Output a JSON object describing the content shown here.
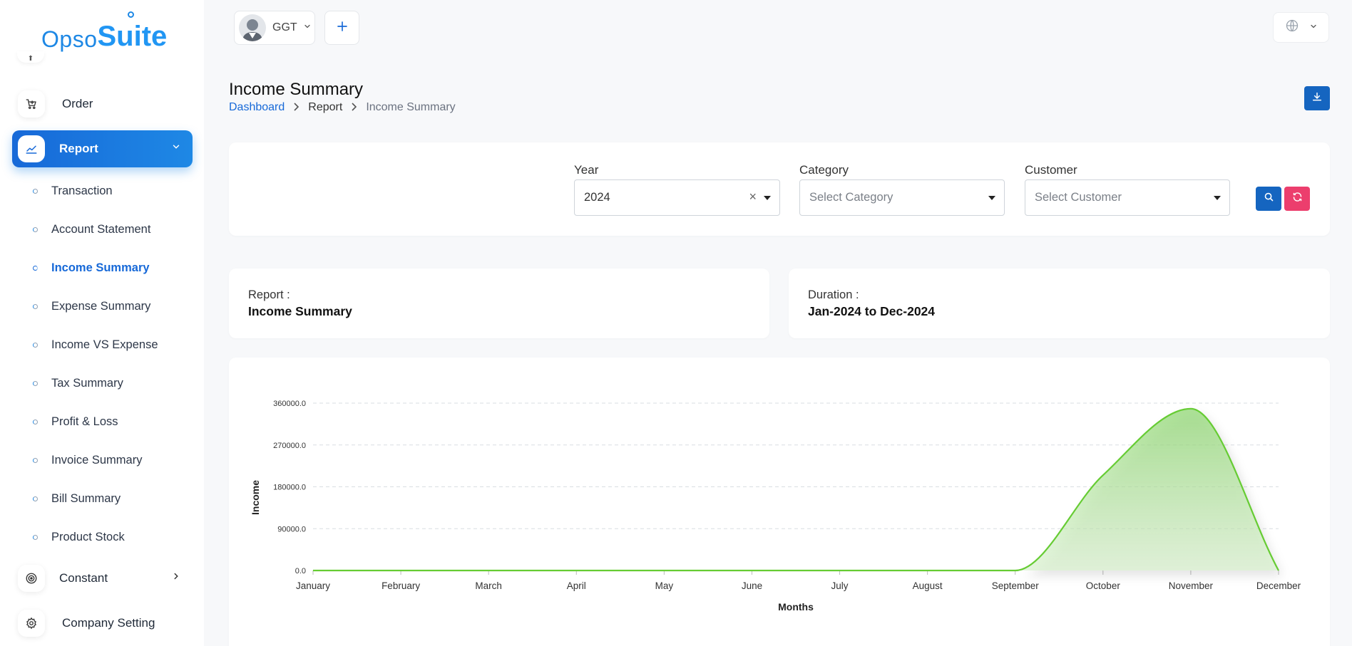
{
  "app": {
    "logo_part1": "Opso",
    "logo_part2": "Suite"
  },
  "topbar": {
    "company_name": "GGT"
  },
  "sidebar": {
    "items": [
      {
        "label": "Order",
        "icon": "cart-icon"
      },
      {
        "label": "Report",
        "icon": "chart-line-icon",
        "active": true,
        "expanded": true
      },
      {
        "label": "Constant",
        "icon": "target-icon"
      },
      {
        "label": "Company Setting",
        "icon": "gear-icon"
      }
    ],
    "report_sub": [
      {
        "label": "Transaction"
      },
      {
        "label": "Account Statement"
      },
      {
        "label": "Income Summary",
        "active": true
      },
      {
        "label": "Expense Summary"
      },
      {
        "label": "Income VS Expense"
      },
      {
        "label": "Tax Summary"
      },
      {
        "label": "Profit & Loss"
      },
      {
        "label": "Invoice Summary"
      },
      {
        "label": "Bill Summary"
      },
      {
        "label": "Product Stock"
      }
    ]
  },
  "page": {
    "title": "Income Summary",
    "breadcrumb": [
      "Dashboard",
      "Report",
      "Income Summary"
    ]
  },
  "filters": {
    "year_label": "Year",
    "year_value": "2024",
    "clear_symbol": "×",
    "category_label": "Category",
    "category_placeholder": "Select Category",
    "customer_label": "Customer",
    "customer_placeholder": "Select Customer"
  },
  "info": {
    "report_key": "Report :",
    "report_value": "Income Summary",
    "duration_key": "Duration :",
    "duration_value": "Jan-2024 to Dec-2024"
  },
  "colors": {
    "primary": "#1565c0",
    "accent_gradient_start": "#1769d8",
    "accent_gradient_end": "#1e88e5",
    "reset": "#ec3e6d",
    "series": "#66cc33"
  },
  "chart_data": {
    "type": "area",
    "categories": [
      "January",
      "February",
      "March",
      "April",
      "May",
      "June",
      "July",
      "August",
      "September",
      "October",
      "November",
      "December"
    ],
    "series": [
      {
        "name": "",
        "values": [
          0,
          0,
          0,
          0,
          0,
          0,
          0,
          0,
          0,
          205000,
          348000,
          0
        ]
      }
    ],
    "xlabel": "Months",
    "ylabel": "Income",
    "ylim": [
      0,
      360000
    ],
    "yticks": [
      "0.0",
      "90000.0",
      "180000.0",
      "270000.0",
      "360000.0"
    ],
    "grid": true,
    "legend": "none"
  }
}
